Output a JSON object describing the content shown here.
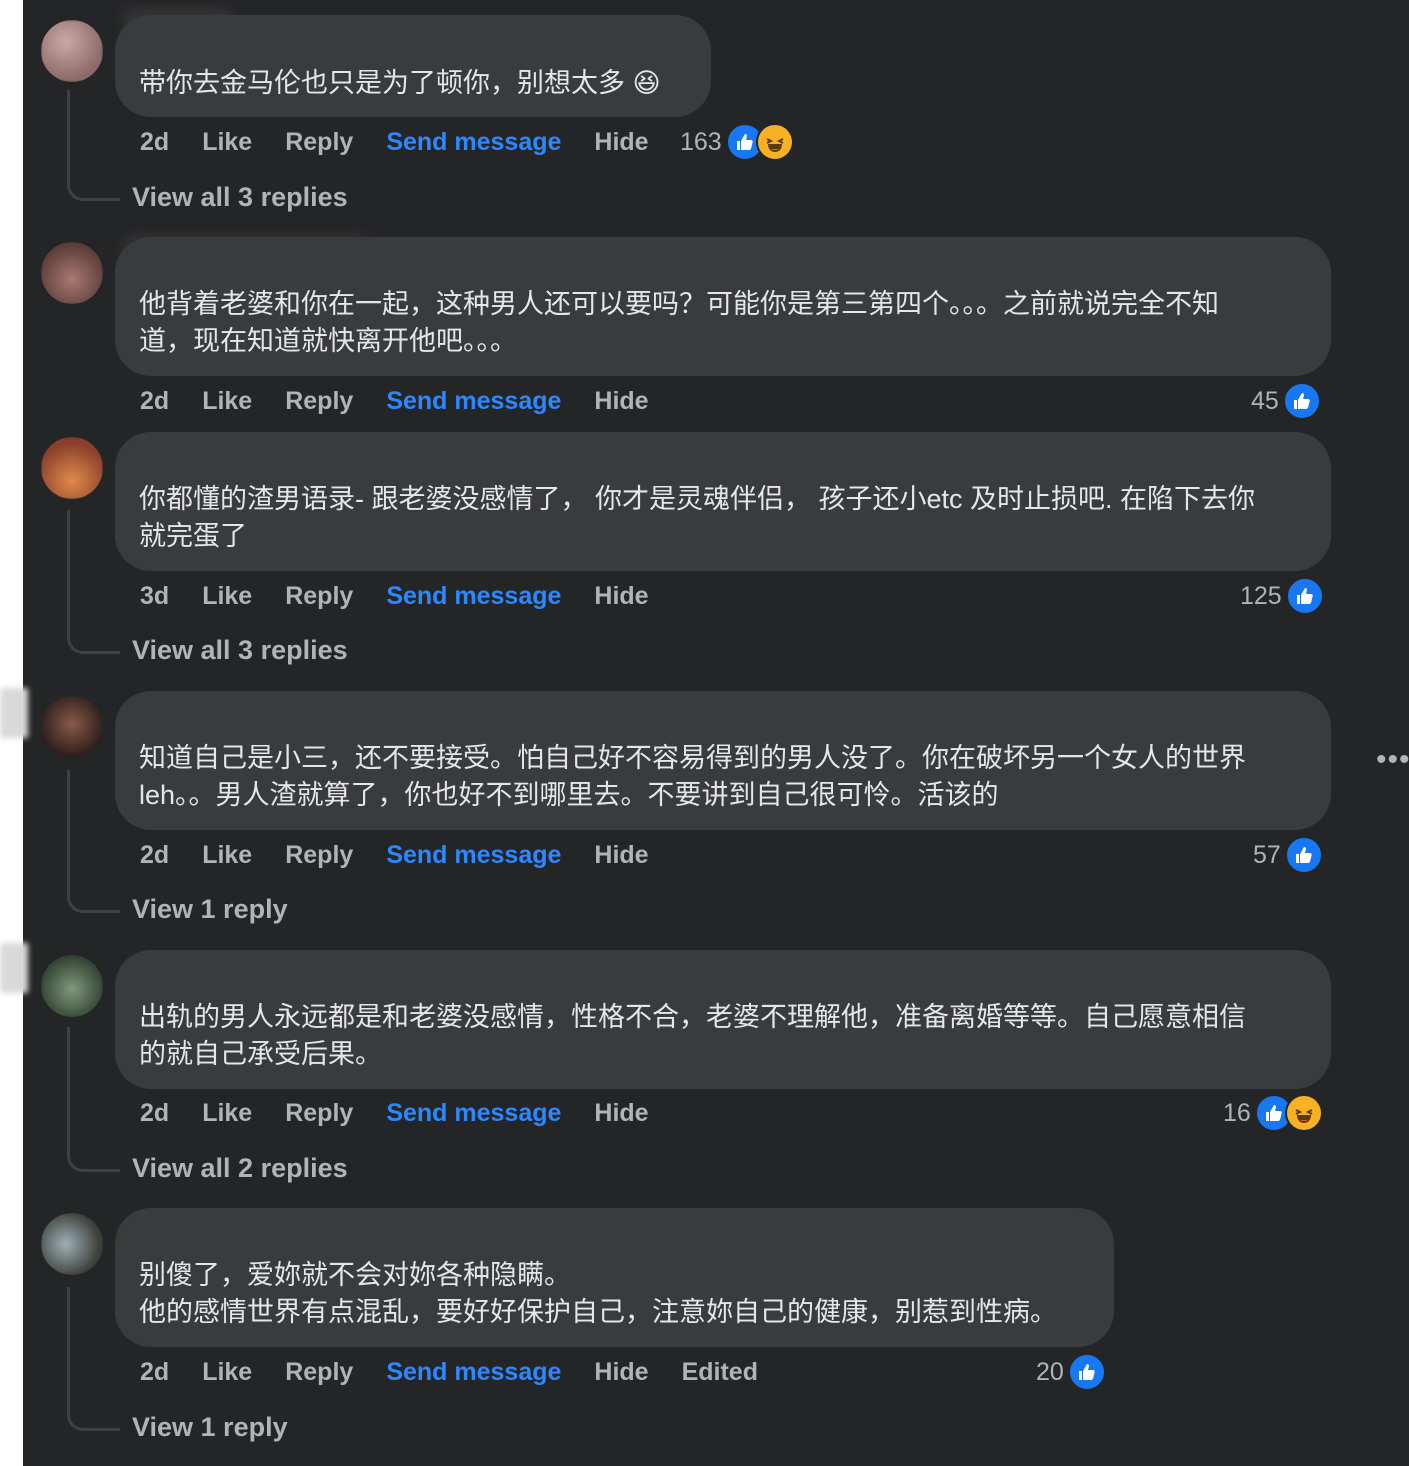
{
  "comments": [
    {
      "text": "带你去金马伦也只是为了顿你，别想太多 😆",
      "time": "2d",
      "like": "Like",
      "reply": "Reply",
      "send": "Send message",
      "hide": "Hide",
      "count": "163",
      "reactions": [
        "like-icon",
        "haha-icon"
      ],
      "view_replies": "View all 3 replies"
    },
    {
      "text": "他背着老婆和你在一起，这种男人还可以要吗？可能你是第三第四个。。。之前就说完全不知\n道，现在知道就快离开他吧。。。",
      "time": "2d",
      "like": "Like",
      "reply": "Reply",
      "send": "Send message",
      "hide": "Hide",
      "count": "45",
      "reactions": [
        "like-icon"
      ]
    },
    {
      "text": "你都懂的渣男语录- 跟老婆没感情了， 你才是灵魂伴侣， 孩子还小etc 及时止损吧. 在陷下去你\n就完蛋了",
      "time": "3d",
      "like": "Like",
      "reply": "Reply",
      "send": "Send message",
      "hide": "Hide",
      "count": "125",
      "reactions": [
        "like-icon"
      ],
      "view_replies": "View all 3 replies"
    },
    {
      "text": "知道自己是小三，还不要接受。怕自己好不容易得到的男人没了。你在破坏另一个女人的世界\nleh。。男人渣就算了，你也好不到哪里去。不要讲到自己很可怜。活该的",
      "time": "2d",
      "like": "Like",
      "reply": "Reply",
      "send": "Send message",
      "hide": "Hide",
      "count": "57",
      "reactions": [
        "like-icon"
      ],
      "view_replies": "View 1 reply"
    },
    {
      "text": "出轨的男人永远都是和老婆没感情，性格不合，老婆不理解他，准备离婚等等。自己愿意相信\n的就自己承受后果。",
      "time": "2d",
      "like": "Like",
      "reply": "Reply",
      "send": "Send message",
      "hide": "Hide",
      "count": "16",
      "reactions": [
        "like-icon",
        "haha-icon"
      ],
      "view_replies": "View all 2 replies"
    },
    {
      "text": "别傻了，爱妳就不会对妳各种隐瞒。\n他的感情世界有点混乱，要好好保护自己，注意妳自己的健康，别惹到性病。",
      "time": "2d",
      "like": "Like",
      "reply": "Reply",
      "send": "Send message",
      "hide": "Hide",
      "edited": "Edited",
      "count": "20",
      "reactions": [
        "like-icon"
      ],
      "view_replies": "View 1 reply"
    }
  ],
  "colors": {
    "panel_bg": "#242526",
    "bubble_bg": "#3a3b3c",
    "text": "#e4e6eb",
    "muted": "#b0b3b8",
    "link_blue": "#2d88ff",
    "like_blue": "#1877f2",
    "haha_yellow": "#f7b125"
  }
}
